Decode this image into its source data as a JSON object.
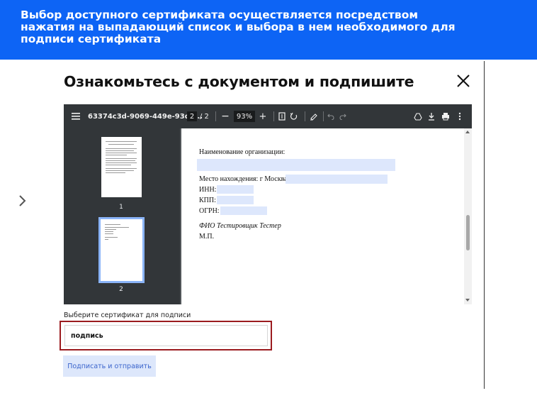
{
  "banner": {
    "lines": [
      "Выбор доступного сертификата осуществляется посредством",
      "нажатия на выпадающий список и выбора в нем необходимого для",
      "подписи сертификата"
    ]
  },
  "dialog": {
    "title": "Ознакомьтесь с документом и подпишите"
  },
  "pdf_viewer": {
    "file_name": "63374c3d-9069-449e-93da...",
    "current_page": "2",
    "page_separator": "/ 2",
    "zoom_minus": "−",
    "zoom_level": "93%",
    "zoom_plus": "+",
    "thumbnails": [
      {
        "number": "1"
      },
      {
        "number": "2"
      }
    ]
  },
  "document": {
    "org_name_label": "Наименование организации:",
    "location_label": "Место нахождения: г Москва,",
    "inn_label": "ИНН:",
    "kpp_label": "КПП:",
    "ogrn_label": "ОГРН:",
    "signer": "ФИО Тестировщик Тестер",
    "seal": "М.П."
  },
  "form": {
    "cert_label": "Выберите сертификат для подписи",
    "cert_value": "подпись",
    "submit_label": "Подписать и отправить"
  },
  "colors": {
    "banner_bg": "#0d64f5",
    "highlight_frame": "#9b1b1f",
    "button_bg": "#dde7fb",
    "button_text": "#3a64cc",
    "field_highlight": "#dde7fc"
  }
}
